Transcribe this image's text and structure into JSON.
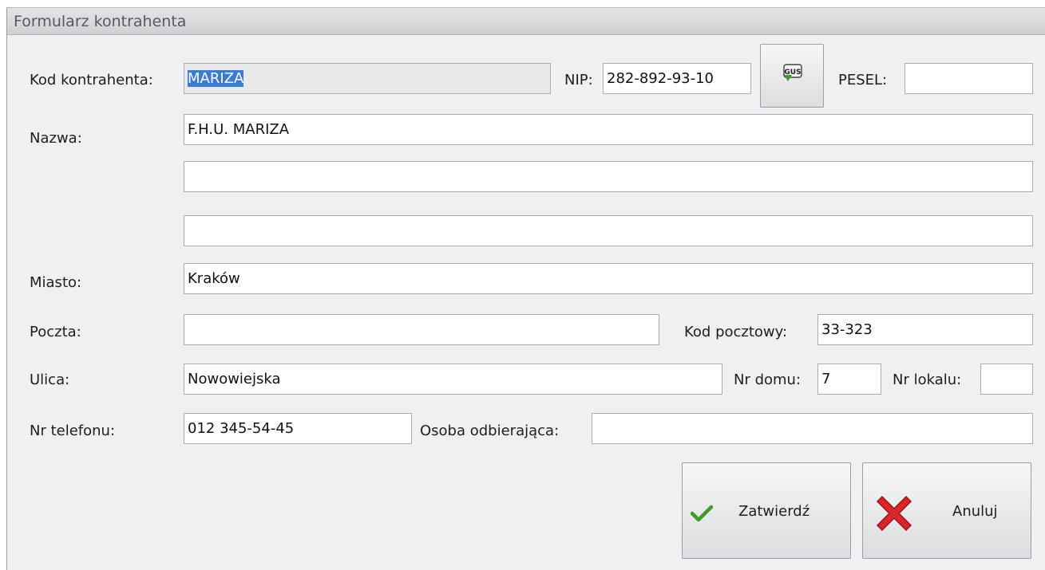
{
  "window": {
    "title": "Formularz kontrahenta"
  },
  "form": {
    "kod_label": "Kod kontrahenta:",
    "kod_value": "MARIZA",
    "nip_label": "NIP:",
    "nip_value": "282-892-93-10",
    "gus_button_text": "GUS",
    "pesel_label": "PESEL:",
    "pesel_value": "",
    "nazwa_label": "Nazwa:",
    "nazwa1_value": "F.H.U. MARIZA",
    "nazwa2_value": "",
    "nazwa3_value": "",
    "miasto_label": "Miasto:",
    "miasto_value": "Kraków",
    "poczta_label": "Poczta:",
    "poczta_value": "",
    "kod_pocztowy_label": "Kod pocztowy:",
    "kod_pocztowy_value": "33-323",
    "ulica_label": "Ulica:",
    "ulica_value": "Nowowiejska",
    "nr_domu_label": "Nr domu:",
    "nr_domu_value": "7",
    "nr_lokalu_label": "Nr lokalu:",
    "nr_lokalu_value": "",
    "telefon_label": "Nr telefonu:",
    "telefon_value": "012 345-54-45",
    "osoba_label": "Osoba odbierająca:",
    "osoba_value": ""
  },
  "buttons": {
    "confirm_label": "Zatwierdź",
    "cancel_label": "Anuluj"
  },
  "icons": {
    "gus": "gus-download-icon",
    "confirm": "checkmark-icon",
    "cancel": "red-x-icon"
  },
  "colors": {
    "selection": "#3a7bd5",
    "check_green": "#3f9a2a",
    "cancel_red": "#d8262b"
  }
}
